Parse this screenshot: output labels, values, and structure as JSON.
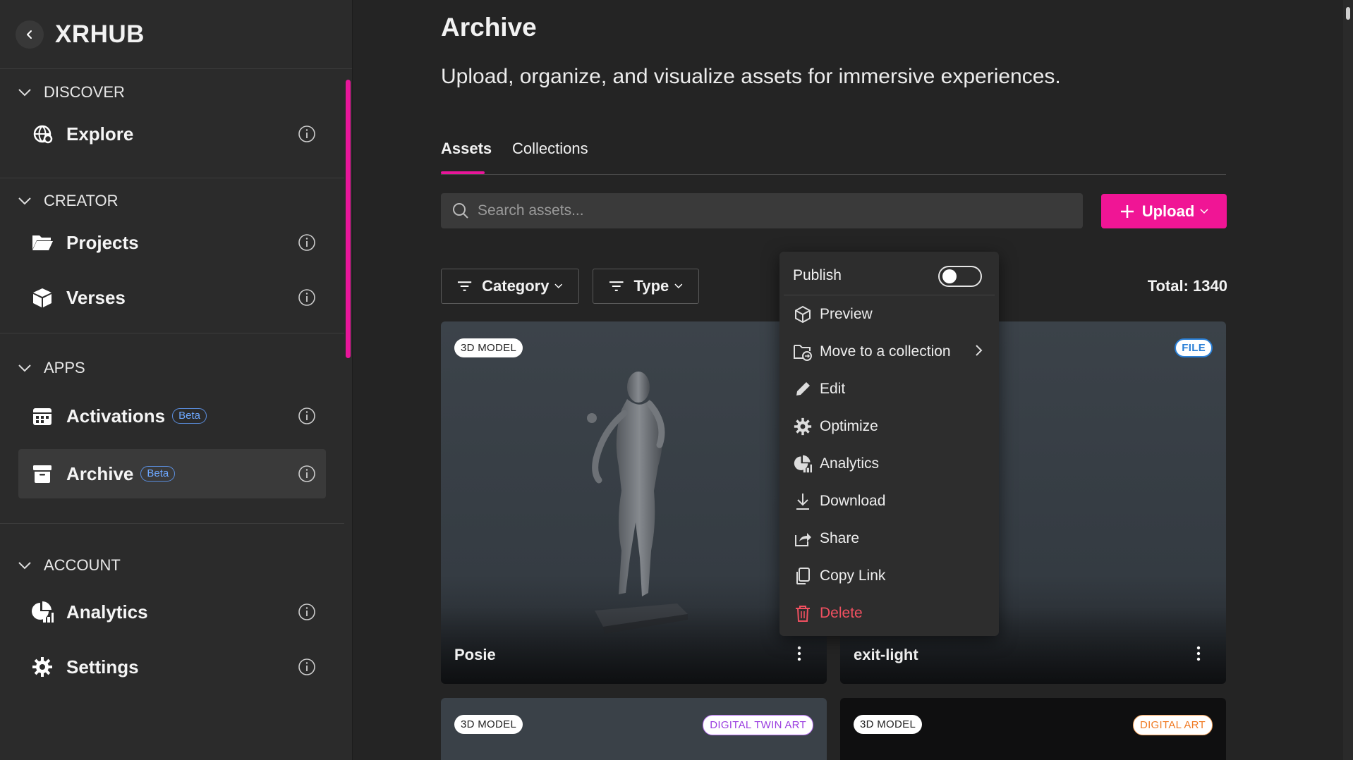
{
  "app": {
    "brand": "XRHUB"
  },
  "sidebar": {
    "sections": [
      {
        "title": "DISCOVER",
        "items": [
          {
            "label": "Explore",
            "icon": "explore-icon"
          }
        ]
      },
      {
        "title": "CREATOR",
        "items": [
          {
            "label": "Projects",
            "icon": "folder-icon"
          },
          {
            "label": "Verses",
            "icon": "cube-icon"
          }
        ]
      },
      {
        "title": "APPS",
        "items": [
          {
            "label": "Activations",
            "icon": "calendar-icon",
            "badge": "Beta"
          },
          {
            "label": "Archive",
            "icon": "archive-icon",
            "badge": "Beta",
            "active": true
          }
        ]
      },
      {
        "title": "ACCOUNT",
        "items": [
          {
            "label": "Analytics",
            "icon": "analytics-icon"
          },
          {
            "label": "Settings",
            "icon": "gear-icon"
          }
        ]
      }
    ]
  },
  "main": {
    "title": "Archive",
    "subtitle": "Upload, organize, and visualize assets for immersive experiences.",
    "tabs": [
      {
        "label": "Assets",
        "active": true
      },
      {
        "label": "Collections"
      }
    ],
    "search": {
      "placeholder": "Search assets..."
    },
    "upload_label": "Upload",
    "filters": {
      "category": "Category",
      "type": "Type"
    },
    "total": "Total: 1340",
    "cards": [
      {
        "title": "Posie",
        "badge": "3D MODEL"
      },
      {
        "title": "exit-light",
        "badge": "FILE"
      },
      {
        "badge": "3D MODEL",
        "tag": "DIGITAL TWIN ART"
      },
      {
        "badge": "3D MODEL",
        "tag": "DIGITAL ART"
      }
    ]
  },
  "context_menu": {
    "publish_label": "Publish",
    "publish_on": false,
    "items": [
      {
        "label": "Preview",
        "icon": "preview-icon"
      },
      {
        "label": "Move to a collection",
        "icon": "move-folder-icon",
        "submenu": true
      },
      {
        "label": "Edit",
        "icon": "pencil-icon"
      },
      {
        "label": "Optimize",
        "icon": "gear-icon"
      },
      {
        "label": "Analytics",
        "icon": "analytics-icon"
      },
      {
        "label": "Download",
        "icon": "download-icon"
      },
      {
        "label": "Share",
        "icon": "share-icon"
      },
      {
        "label": "Copy Link",
        "icon": "copy-icon"
      },
      {
        "label": "Delete",
        "icon": "trash-icon",
        "danger": true
      }
    ]
  },
  "colors": {
    "accent": "#f01595",
    "beta": "#5b8fe0",
    "danger": "#f05060",
    "background": "#242424",
    "sidebar": "#2b2b2b"
  }
}
